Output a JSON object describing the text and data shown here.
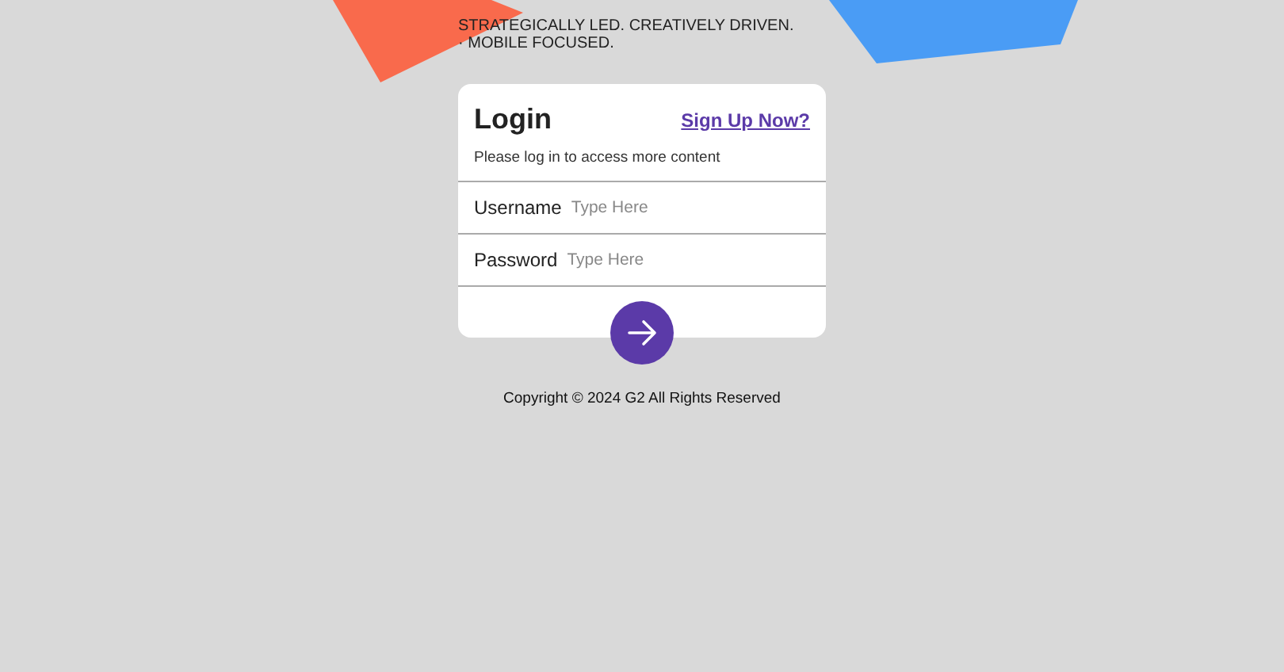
{
  "tagline": "STRATEGICALLY LED. CREATIVELY DRIVEN. · MOBILE FOCUSED.",
  "login": {
    "title": "Login",
    "signup_link": "Sign Up Now?",
    "subtitle": "Please log in to access more content",
    "fields": [
      {
        "label": "Username",
        "placeholder": "Type Here"
      },
      {
        "label": "Password",
        "placeholder": "Type Here"
      }
    ]
  },
  "copyright": "Copyright © 2024 G2 All Rights Reserved"
}
